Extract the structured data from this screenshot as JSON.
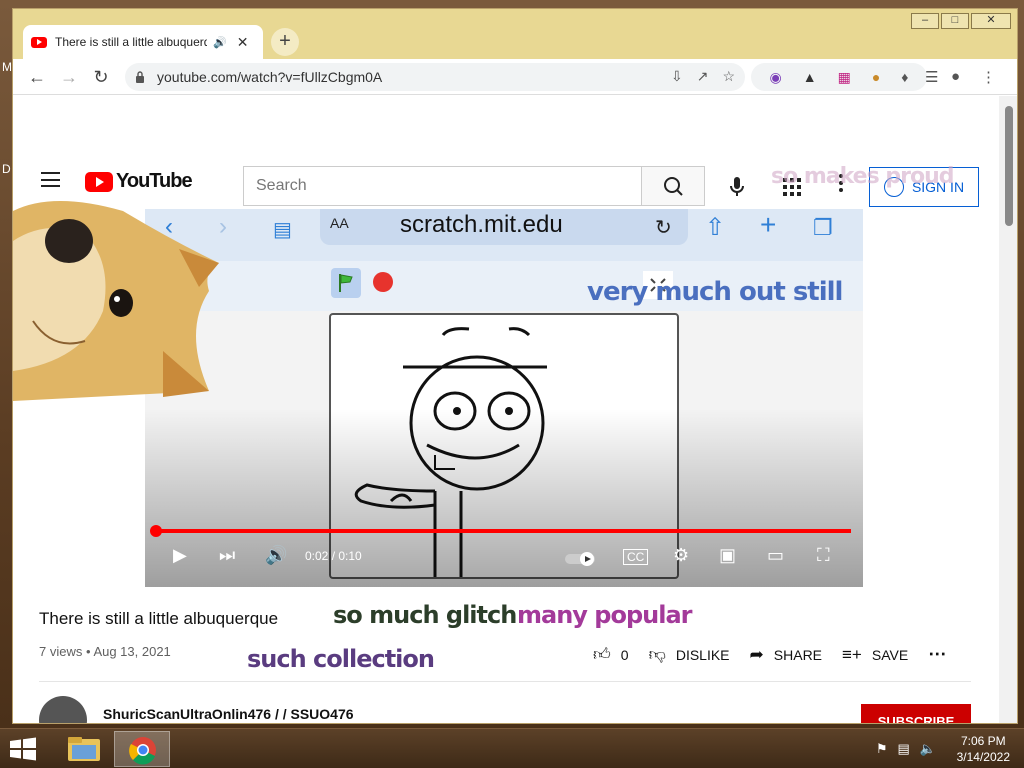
{
  "window": {
    "tab_title": "There is still a little albuquerque",
    "tab_audio_icon": "speaker-icon",
    "url": "youtube.com/watch?v=fUllzCbgm0A",
    "controls": [
      "minimize",
      "maximize",
      "close"
    ]
  },
  "youtube": {
    "logo_text": "YouTube",
    "search_placeholder": "Search",
    "sign_in": "SIGN IN"
  },
  "video": {
    "ios_url": "scratch.mit.edu",
    "ios_aa": "AA",
    "time": "0:02 / 0:10",
    "progress": 1.0
  },
  "overlays": {
    "very_much": "very much out still",
    "so_much_glitch": "so much glitch",
    "many_popular": "many popular",
    "such_collection": "such collection",
    "so_makes": "so makes proud"
  },
  "info": {
    "title": "There is still a little albuquerque",
    "views": "7 views",
    "date": "Aug 13, 2021",
    "likes": "0",
    "dislike": "DISLIKE",
    "share": "SHARE",
    "save": "SAVE",
    "channel": "ShuricScanUltraOnlin476 / / SSUO476",
    "subscribe": "SUBSCRIBE"
  },
  "taskbar": {
    "time": "7:06 PM",
    "date": "3/14/2022"
  },
  "colors": {
    "youtube_red": "#ff0000",
    "link_blue": "#065fd4",
    "titlebar": "#e8d893"
  }
}
